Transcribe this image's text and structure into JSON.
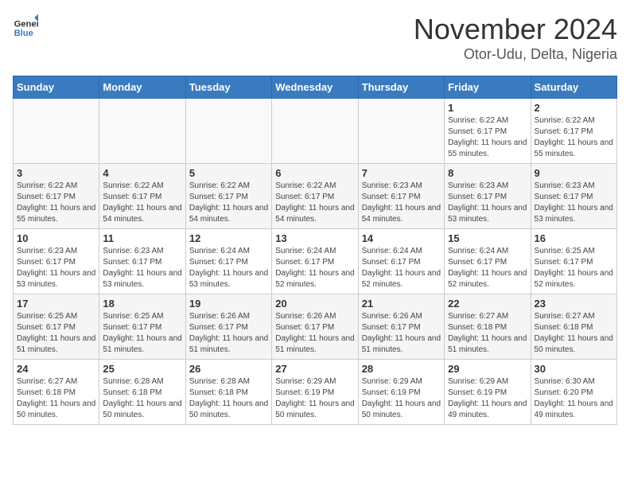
{
  "logo": {
    "general": "General",
    "blue": "Blue"
  },
  "title": {
    "month_year": "November 2024",
    "location": "Otor-Udu, Delta, Nigeria"
  },
  "days_of_week": [
    "Sunday",
    "Monday",
    "Tuesday",
    "Wednesday",
    "Thursday",
    "Friday",
    "Saturday"
  ],
  "weeks": [
    [
      {
        "day": "",
        "info": ""
      },
      {
        "day": "",
        "info": ""
      },
      {
        "day": "",
        "info": ""
      },
      {
        "day": "",
        "info": ""
      },
      {
        "day": "",
        "info": ""
      },
      {
        "day": "1",
        "info": "Sunrise: 6:22 AM\nSunset: 6:17 PM\nDaylight: 11 hours and 55 minutes."
      },
      {
        "day": "2",
        "info": "Sunrise: 6:22 AM\nSunset: 6:17 PM\nDaylight: 11 hours and 55 minutes."
      }
    ],
    [
      {
        "day": "3",
        "info": "Sunrise: 6:22 AM\nSunset: 6:17 PM\nDaylight: 11 hours and 55 minutes."
      },
      {
        "day": "4",
        "info": "Sunrise: 6:22 AM\nSunset: 6:17 PM\nDaylight: 11 hours and 54 minutes."
      },
      {
        "day": "5",
        "info": "Sunrise: 6:22 AM\nSunset: 6:17 PM\nDaylight: 11 hours and 54 minutes."
      },
      {
        "day": "6",
        "info": "Sunrise: 6:22 AM\nSunset: 6:17 PM\nDaylight: 11 hours and 54 minutes."
      },
      {
        "day": "7",
        "info": "Sunrise: 6:23 AM\nSunset: 6:17 PM\nDaylight: 11 hours and 54 minutes."
      },
      {
        "day": "8",
        "info": "Sunrise: 6:23 AM\nSunset: 6:17 PM\nDaylight: 11 hours and 53 minutes."
      },
      {
        "day": "9",
        "info": "Sunrise: 6:23 AM\nSunset: 6:17 PM\nDaylight: 11 hours and 53 minutes."
      }
    ],
    [
      {
        "day": "10",
        "info": "Sunrise: 6:23 AM\nSunset: 6:17 PM\nDaylight: 11 hours and 53 minutes."
      },
      {
        "day": "11",
        "info": "Sunrise: 6:23 AM\nSunset: 6:17 PM\nDaylight: 11 hours and 53 minutes."
      },
      {
        "day": "12",
        "info": "Sunrise: 6:24 AM\nSunset: 6:17 PM\nDaylight: 11 hours and 53 minutes."
      },
      {
        "day": "13",
        "info": "Sunrise: 6:24 AM\nSunset: 6:17 PM\nDaylight: 11 hours and 52 minutes."
      },
      {
        "day": "14",
        "info": "Sunrise: 6:24 AM\nSunset: 6:17 PM\nDaylight: 11 hours and 52 minutes."
      },
      {
        "day": "15",
        "info": "Sunrise: 6:24 AM\nSunset: 6:17 PM\nDaylight: 11 hours and 52 minutes."
      },
      {
        "day": "16",
        "info": "Sunrise: 6:25 AM\nSunset: 6:17 PM\nDaylight: 11 hours and 52 minutes."
      }
    ],
    [
      {
        "day": "17",
        "info": "Sunrise: 6:25 AM\nSunset: 6:17 PM\nDaylight: 11 hours and 51 minutes."
      },
      {
        "day": "18",
        "info": "Sunrise: 6:25 AM\nSunset: 6:17 PM\nDaylight: 11 hours and 51 minutes."
      },
      {
        "day": "19",
        "info": "Sunrise: 6:26 AM\nSunset: 6:17 PM\nDaylight: 11 hours and 51 minutes."
      },
      {
        "day": "20",
        "info": "Sunrise: 6:26 AM\nSunset: 6:17 PM\nDaylight: 11 hours and 51 minutes."
      },
      {
        "day": "21",
        "info": "Sunrise: 6:26 AM\nSunset: 6:17 PM\nDaylight: 11 hours and 51 minutes."
      },
      {
        "day": "22",
        "info": "Sunrise: 6:27 AM\nSunset: 6:18 PM\nDaylight: 11 hours and 51 minutes."
      },
      {
        "day": "23",
        "info": "Sunrise: 6:27 AM\nSunset: 6:18 PM\nDaylight: 11 hours and 50 minutes."
      }
    ],
    [
      {
        "day": "24",
        "info": "Sunrise: 6:27 AM\nSunset: 6:18 PM\nDaylight: 11 hours and 50 minutes."
      },
      {
        "day": "25",
        "info": "Sunrise: 6:28 AM\nSunset: 6:18 PM\nDaylight: 11 hours and 50 minutes."
      },
      {
        "day": "26",
        "info": "Sunrise: 6:28 AM\nSunset: 6:18 PM\nDaylight: 11 hours and 50 minutes."
      },
      {
        "day": "27",
        "info": "Sunrise: 6:29 AM\nSunset: 6:19 PM\nDaylight: 11 hours and 50 minutes."
      },
      {
        "day": "28",
        "info": "Sunrise: 6:29 AM\nSunset: 6:19 PM\nDaylight: 11 hours and 50 minutes."
      },
      {
        "day": "29",
        "info": "Sunrise: 6:29 AM\nSunset: 6:19 PM\nDaylight: 11 hours and 49 minutes."
      },
      {
        "day": "30",
        "info": "Sunrise: 6:30 AM\nSunset: 6:20 PM\nDaylight: 11 hours and 49 minutes."
      }
    ]
  ]
}
